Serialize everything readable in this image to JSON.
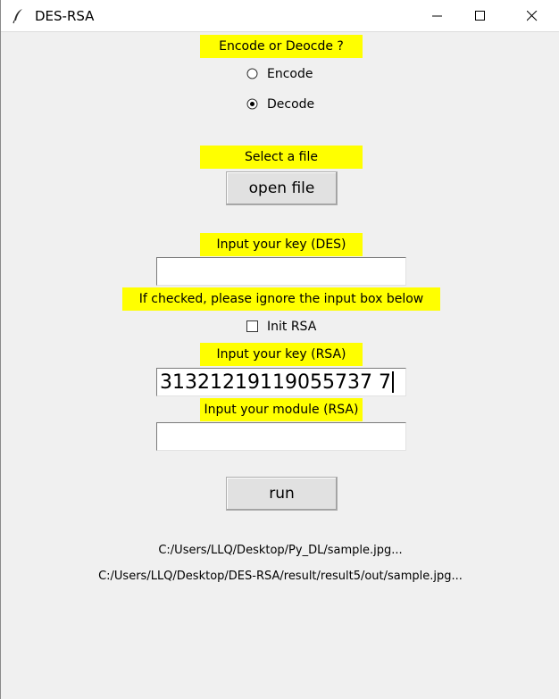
{
  "window": {
    "title": "DES-RSA",
    "icon": "feather-icon",
    "controls": [
      "minimize-icon",
      "maximize-icon",
      "close-icon"
    ]
  },
  "mode": {
    "prompt": "Encode or Deocde ?",
    "options": [
      {
        "label": "Encode",
        "selected": false
      },
      {
        "label": "Decode",
        "selected": true
      }
    ]
  },
  "file": {
    "prompt": "Select a file",
    "button_label": "open file"
  },
  "des": {
    "prompt": "Input your key (DES)",
    "value": ""
  },
  "rsa_init": {
    "note": "If checked, please ignore the input box below",
    "checkbox_label": "Init RSA",
    "checked": false
  },
  "rsa_key": {
    "prompt": "Input your key (RSA)",
    "value": "31321219119055737 7"
  },
  "rsa_module": {
    "prompt": "Input your module (RSA)",
    "value": ""
  },
  "run": {
    "button_label": "run"
  },
  "paths": {
    "input": "C:/Users/LLQ/Desktop/Py_DL/sample.jpg...",
    "output": "C:/Users/LLQ/Desktop/DES-RSA/result/result5/out/sample.jpg..."
  },
  "colors": {
    "label_bg": "#ffff00",
    "window_bg": "#f0f0f0"
  }
}
